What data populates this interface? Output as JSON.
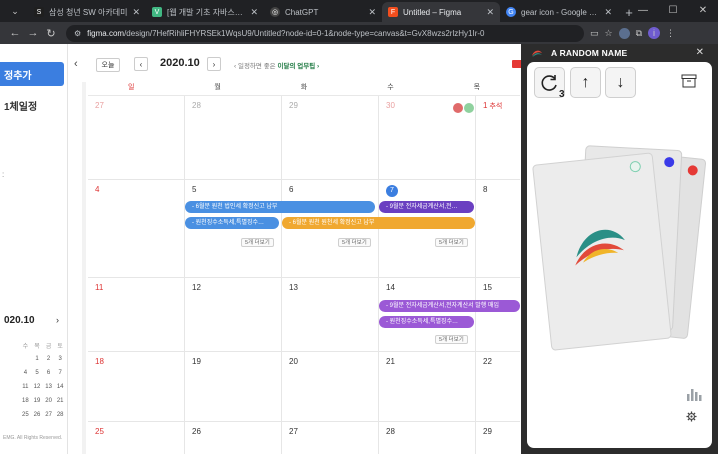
{
  "tabs": [
    {
      "favicon_text": "S",
      "favicon_color": "#1f1f1f",
      "title": "삼성 청년 SW 아카데미",
      "active": false
    },
    {
      "favicon_text": "V",
      "favicon_color": "#41b883",
      "title": "[웹 개발 기초 자바스크립",
      "active": false
    },
    {
      "favicon_text": "◎",
      "favicon_color": "#444444",
      "title": "ChatGPT",
      "active": false
    },
    {
      "favicon_text": "F",
      "favicon_color": "#f24e1e",
      "title": "Untitled – Figma",
      "active": true
    },
    {
      "favicon_text": "G",
      "favicon_color": "#4285f4",
      "title": "gear icon - Google Search",
      "active": false
    }
  ],
  "address": {
    "host": "figma.com",
    "path": "/design/7HefRihliFHYRSEk1WqsU9/Untitled?node-id=0-1&node-type=canvas&t=GvX8wzs2rlzHy1Ir-0"
  },
  "left": {
    "add_label": "정추가",
    "all_day_label": "1체일정",
    "mini_title": "020.10",
    "mini_next": "›",
    "mini_dow": [
      "",
      "수",
      "목",
      "금",
      "토"
    ],
    "mini_weeks": [
      [
        "",
        "",
        "1",
        "2",
        "3"
      ],
      [
        "",
        "4",
        "5",
        "6",
        "7"
      ],
      [
        "",
        "11",
        "12",
        "13",
        "14"
      ],
      [
        "",
        "18",
        "19",
        "20",
        "21"
      ],
      [
        "",
        "25",
        "26",
        "27",
        "28"
      ]
    ],
    "copyright": "EMG. All Rights Reserved."
  },
  "calendar": {
    "today_label": "오늘",
    "prev": "‹",
    "next": "›",
    "month": "2020.10",
    "hint_prefix": "‹ 일정하면 좋은",
    "hint_link": "이달의 업무팁 ›",
    "weekdays": [
      "일",
      "월",
      "화",
      "수",
      "목"
    ],
    "weeks": [
      {
        "days": [
          "27",
          "28",
          "29",
          "30",
          "1"
        ],
        "holiday": "추석"
      },
      {
        "days": [
          "4",
          "5",
          "6",
          "7",
          "8"
        ]
      },
      {
        "days": [
          "11",
          "12",
          "13",
          "14",
          "15"
        ]
      },
      {
        "days": [
          "18",
          "19",
          "20",
          "21",
          "22"
        ]
      },
      {
        "days": [
          "25",
          "26",
          "27",
          "28",
          "29"
        ]
      }
    ],
    "events": {
      "e1": "- 6월분 원천 법인세 확정신고 납부",
      "e2": "- 9월분 전자세금계산서,전…",
      "e3": "- 원천징수소득세,특별징수…",
      "e4": "- 6월분 원천 원천세 확정신고 납부",
      "e5": "- 9월분 전자세금계산서,전자계산서 발행 매입",
      "e6": "- 원천징수소득세,특별징수…"
    },
    "more_label": "5개 더보기",
    "colors": {
      "blue": "#4a90e2",
      "purple": "#6a3fc1",
      "orange": "#f0a830",
      "lavender": "#9b59d6"
    }
  },
  "plugin": {
    "title": "A RANDOM NAME",
    "close": "✕",
    "refresh_count": "3",
    "up": "↑",
    "down": "↓"
  }
}
